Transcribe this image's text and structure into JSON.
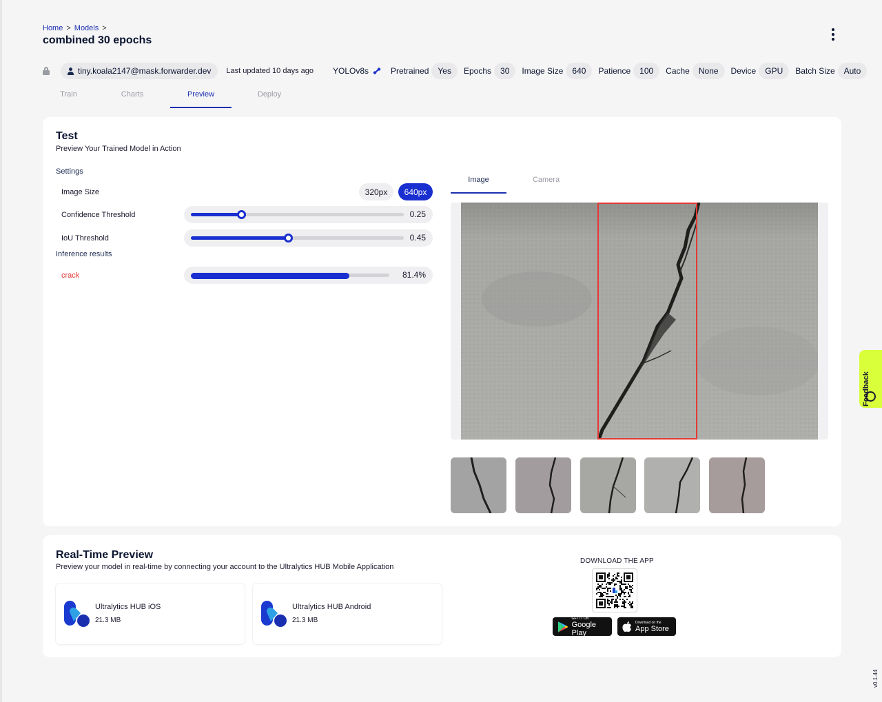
{
  "breadcrumb": [
    "Home",
    "Models"
  ],
  "breadcrumb_sep": ">",
  "title": "combined 30 epochs",
  "meta": {
    "user": "tiny.koala2147@mask.forwarder.dev",
    "updated": "Last updated 10 days ago",
    "architecture": "YOLOv8s",
    "pretrained": {
      "label": "Pretrained",
      "value": "Yes"
    },
    "epochs": {
      "label": "Epochs",
      "value": "30"
    },
    "image_size": {
      "label": "Image Size",
      "value": "640"
    },
    "patience": {
      "label": "Patience",
      "value": "100"
    },
    "cache": {
      "label": "Cache",
      "value": "None"
    },
    "device": {
      "label": "Device",
      "value": "GPU"
    },
    "batch_size": {
      "label": "Batch Size",
      "value": "Auto"
    }
  },
  "tabs": [
    "Train",
    "Charts",
    "Preview",
    "Deploy"
  ],
  "active_tab": "Preview",
  "test": {
    "title": "Test",
    "subtitle": "Preview Your Trained Model in Action",
    "settings_label": "Settings",
    "image_size_label": "Image Size",
    "image_size_options": [
      "320px",
      "640px"
    ],
    "image_size_selected": "640px",
    "confidence_label": "Confidence Threshold",
    "confidence_value": "0.25",
    "confidence_fraction": 0.25,
    "iou_label": "IoU Threshold",
    "iou_value": "0.45",
    "iou_fraction": 0.45,
    "inference_label": "Inference results",
    "results": [
      {
        "label": "crack",
        "value": "81.4%",
        "fraction": 0.814
      }
    ],
    "preview_tabs": [
      "Image",
      "Camera"
    ],
    "active_preview_tab": "Image"
  },
  "realtime": {
    "title": "Real-Time Preview",
    "subtitle": "Preview your model in real-time by connecting your account to the Ultralytics HUB Mobile Application",
    "apps": [
      {
        "name": "Ultralytics HUB iOS",
        "size": "21.3 MB"
      },
      {
        "name": "Ultralytics HUB Android",
        "size": "21.3 MB"
      }
    ],
    "download_label": "DOWNLOAD THE APP",
    "google_play": {
      "small": "GET IT ON",
      "big": "Google Play"
    },
    "app_store": {
      "small": "Download on the",
      "big": "App Store"
    }
  },
  "feedback_label": "Feedback",
  "version": "v0.1.44",
  "colors": {
    "accent": "#1a2fd0",
    "result": "#e53935",
    "box": "#e53935",
    "feedback": "#d9ff3b"
  }
}
